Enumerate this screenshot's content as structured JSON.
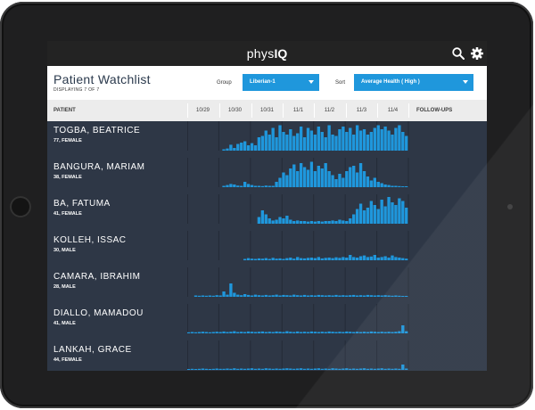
{
  "app": {
    "logo_left": "phys",
    "logo_right": "IQ"
  },
  "header": {
    "title": "Patient Watchlist",
    "subtitle": "DISPLAYING 7 OF 7",
    "group_label": "Group",
    "group_value": "Liberian-1",
    "sort_label": "Sort",
    "sort_value": "Average Health ( High )"
  },
  "table": {
    "patient_header": "PATIENT",
    "dates": [
      "10/29",
      "10/30",
      "10/31",
      "11/1",
      "11/2",
      "11/3",
      "11/4"
    ],
    "followups_header": "FOLLOW-UPS"
  },
  "patients": [
    {
      "name": "TOGBA, BEATRICE",
      "meta": "77, FEMALE",
      "activity": [
        0,
        0,
        0,
        0,
        0,
        0,
        0,
        0,
        0,
        0,
        0.05,
        0.08,
        0.22,
        0.1,
        0.25,
        0.3,
        0.35,
        0.2,
        0.28,
        0.2,
        0.5,
        0.55,
        0.75,
        0.6,
        0.85,
        0.5,
        0.95,
        0.7,
        0.6,
        0.8,
        0.55,
        0.65,
        0.9,
        0.5,
        0.85,
        0.75,
        0.6,
        0.9,
        0.7,
        0.5,
        0.95,
        0.6,
        0.55,
        0.8,
        0.9,
        0.7,
        0.85,
        0.6,
        0.95,
        0.75,
        0.8,
        0.6,
        0.7,
        0.85,
        0.95,
        0.8,
        0.9,
        0.75,
        0.6,
        0.85,
        0.95,
        0.7,
        0.55
      ]
    },
    {
      "name": "BANGURA, MARIAM",
      "meta": "38, FEMALE",
      "activity": [
        0,
        0,
        0,
        0,
        0,
        0,
        0,
        0,
        0,
        0,
        0.05,
        0.08,
        0.12,
        0.1,
        0.06,
        0.05,
        0.2,
        0.12,
        0.08,
        0.05,
        0.05,
        0.04,
        0.06,
        0.05,
        0.05,
        0.2,
        0.35,
        0.55,
        0.45,
        0.7,
        0.85,
        0.6,
        0.9,
        0.75,
        0.65,
        0.95,
        0.6,
        0.8,
        0.7,
        0.9,
        0.6,
        0.45,
        0.3,
        0.5,
        0.35,
        0.6,
        0.75,
        0.8,
        0.55,
        0.9,
        0.6,
        0.4,
        0.25,
        0.35,
        0.2,
        0.15,
        0.1,
        0.08,
        0.05,
        0.05,
        0.04,
        0.03,
        0.03
      ]
    },
    {
      "name": "BA, FATUMA",
      "meta": "41, FEMALE",
      "activity": [
        0,
        0,
        0,
        0,
        0,
        0,
        0,
        0,
        0,
        0,
        0,
        0,
        0,
        0,
        0,
        0,
        0,
        0,
        0,
        0,
        0.25,
        0.5,
        0.35,
        0.2,
        0.12,
        0.15,
        0.25,
        0.2,
        0.3,
        0.15,
        0.1,
        0.12,
        0.1,
        0.1,
        0.08,
        0.1,
        0.08,
        0.1,
        0.08,
        0.1,
        0.1,
        0.12,
        0.1,
        0.15,
        0.12,
        0.1,
        0.2,
        0.35,
        0.55,
        0.75,
        0.5,
        0.6,
        0.85,
        0.7,
        0.55,
        0.9,
        0.65,
        1.0,
        0.8,
        0.7,
        0.95,
        0.85,
        0.6
      ]
    },
    {
      "name": "KOLLEH, ISSAC",
      "meta": "30, MALE",
      "activity": [
        0,
        0,
        0,
        0,
        0,
        0,
        0,
        0,
        0,
        0,
        0,
        0,
        0,
        0,
        0,
        0,
        0.05,
        0.08,
        0.06,
        0.05,
        0.07,
        0.06,
        0.08,
        0.05,
        0.09,
        0.06,
        0.07,
        0.05,
        0.08,
        0.1,
        0.06,
        0.12,
        0.08,
        0.07,
        0.09,
        0.1,
        0.08,
        0.12,
        0.07,
        0.09,
        0.1,
        0.08,
        0.11,
        0.09,
        0.12,
        0.1,
        0.2,
        0.12,
        0.1,
        0.15,
        0.18,
        0.12,
        0.14,
        0.2,
        0.1,
        0.12,
        0.15,
        0.1,
        0.18,
        0.12,
        0.1,
        0.08,
        0.06
      ]
    },
    {
      "name": "CAMARA, IBRAHIM",
      "meta": "28, MALE",
      "activity": [
        0,
        0,
        0.05,
        0.04,
        0.05,
        0.04,
        0.05,
        0.04,
        0.06,
        0.05,
        0.2,
        0.08,
        0.5,
        0.15,
        0.08,
        0.06,
        0.1,
        0.07,
        0.05,
        0.08,
        0.06,
        0.05,
        0.07,
        0.05,
        0.06,
        0.08,
        0.05,
        0.07,
        0.06,
        0.05,
        0.08,
        0.06,
        0.05,
        0.07,
        0.05,
        0.06,
        0.05,
        0.07,
        0.06,
        0.05,
        0.06,
        0.05,
        0.07,
        0.05,
        0.06,
        0.05,
        0.06,
        0.07,
        0.05,
        0.06,
        0.05,
        0.07,
        0.06,
        0.05,
        0.06,
        0.05,
        0.06,
        0.05,
        0.04,
        0.05,
        0.04,
        0.03,
        0.03
      ]
    },
    {
      "name": "DIALLO, MAMADOU",
      "meta": "41, MALE",
      "activity": [
        0.04,
        0.05,
        0.04,
        0.05,
        0.06,
        0.05,
        0.04,
        0.05,
        0.06,
        0.05,
        0.07,
        0.05,
        0.06,
        0.08,
        0.05,
        0.06,
        0.05,
        0.07,
        0.06,
        0.05,
        0.06,
        0.07,
        0.05,
        0.06,
        0.05,
        0.07,
        0.06,
        0.05,
        0.08,
        0.06,
        0.05,
        0.07,
        0.05,
        0.06,
        0.05,
        0.07,
        0.06,
        0.05,
        0.06,
        0.05,
        0.07,
        0.06,
        0.05,
        0.06,
        0.05,
        0.07,
        0.06,
        0.05,
        0.06,
        0.05,
        0.06,
        0.05,
        0.07,
        0.06,
        0.05,
        0.06,
        0.05,
        0.06,
        0.05,
        0.06,
        0.08,
        0.3,
        0.08
      ]
    },
    {
      "name": "LANKAH, GRACE",
      "meta": "44, FEMALE",
      "activity": [
        0.03,
        0.04,
        0.03,
        0.04,
        0.05,
        0.04,
        0.03,
        0.04,
        0.05,
        0.04,
        0.04,
        0.05,
        0.04,
        0.06,
        0.04,
        0.05,
        0.04,
        0.05,
        0.06,
        0.04,
        0.05,
        0.04,
        0.06,
        0.05,
        0.04,
        0.05,
        0.04,
        0.05,
        0.06,
        0.05,
        0.04,
        0.05,
        0.06,
        0.04,
        0.05,
        0.04,
        0.05,
        0.06,
        0.04,
        0.05,
        0.04,
        0.06,
        0.05,
        0.04,
        0.05,
        0.06,
        0.04,
        0.05,
        0.04,
        0.05,
        0.06,
        0.04,
        0.05,
        0.04,
        0.05,
        0.06,
        0.04,
        0.05,
        0.04,
        0.05,
        0.04,
        0.2,
        0.05
      ]
    }
  ],
  "colors": {
    "bezel": "#1f1f20",
    "topbar": "#232323",
    "row_bg": "#2e3746",
    "accent": "#1f97dc",
    "header_bg": "#ffffff",
    "column_header_bg": "#ececec"
  }
}
